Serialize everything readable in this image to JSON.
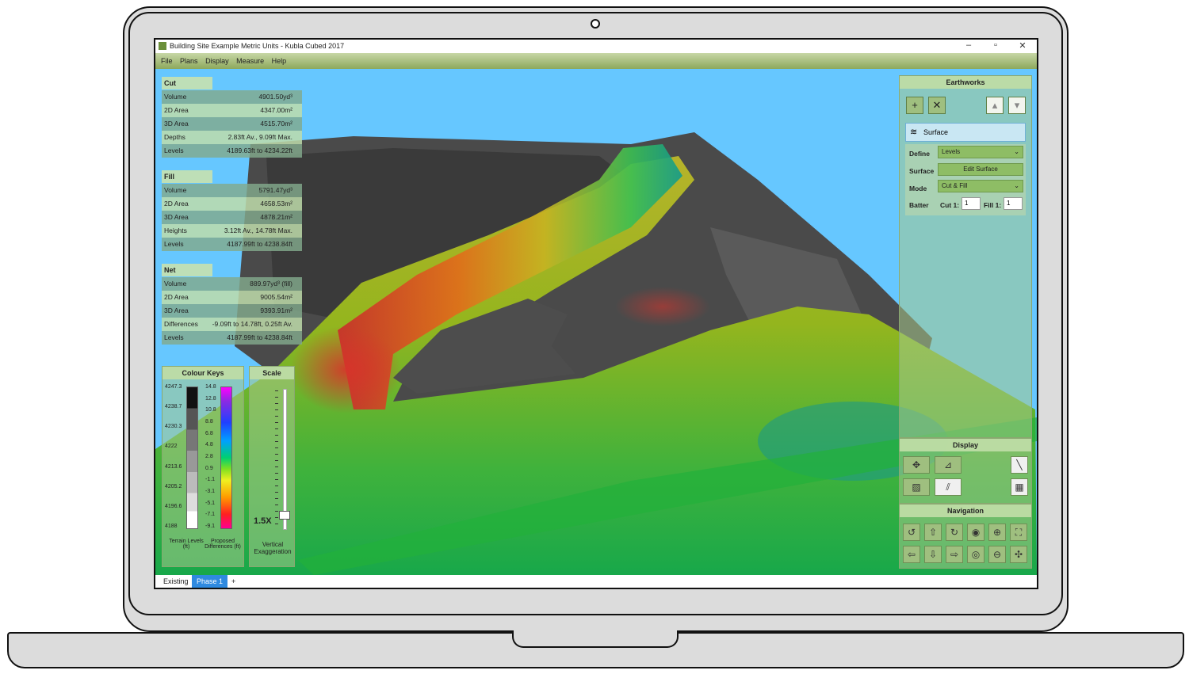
{
  "window": {
    "title": "Building Site Example Metric Units - Kubla Cubed 2017"
  },
  "menu": [
    "File",
    "Plans",
    "Display",
    "Measure",
    "Help"
  ],
  "cut": {
    "title": "Cut",
    "rows": [
      {
        "k": "Volume",
        "v": "4901.50yd³"
      },
      {
        "k": "2D Area",
        "v": "4347.00m²"
      },
      {
        "k": "3D Area",
        "v": "4515.70m²"
      },
      {
        "k": "Depths",
        "v": "2.83ft Av., 9.09ft Max."
      },
      {
        "k": "Levels",
        "v": "4189.63ft to 4234.22ft"
      }
    ]
  },
  "fill": {
    "title": "Fill",
    "rows": [
      {
        "k": "Volume",
        "v": "5791.47yd³"
      },
      {
        "k": "2D Area",
        "v": "4658.53m²"
      },
      {
        "k": "3D Area",
        "v": "4878.21m²"
      },
      {
        "k": "Heights",
        "v": "3.12ft Av., 14.78ft Max."
      },
      {
        "k": "Levels",
        "v": "4187.99ft to 4238.84ft"
      }
    ]
  },
  "net": {
    "title": "Net",
    "rows": [
      {
        "k": "Volume",
        "v": "889.97yd³ (fill)"
      },
      {
        "k": "2D Area",
        "v": "9005.54m²"
      },
      {
        "k": "3D Area",
        "v": "9393.91m²"
      },
      {
        "k": "Differences",
        "v": "-9.09ft to 14.78ft, 0.25ft Av."
      },
      {
        "k": "Levels",
        "v": "4187.99ft to 4238.84ft"
      }
    ]
  },
  "colour_keys": {
    "title": "Colour Keys",
    "terrain_ticks": [
      "4247.3",
      "4238.7",
      "4230.3",
      "4222",
      "4213.6",
      "4205.2",
      "4196.6",
      "4188"
    ],
    "diff_ticks": [
      "14.8",
      "12.8",
      "10.8",
      "8.8",
      "6.8",
      "4.8",
      "2.8",
      "0.9",
      "-1.1",
      "-3.1",
      "-5.1",
      "-7.1",
      "-9.1"
    ],
    "terrain_label": "Terrain Levels (ft)",
    "diff_label": "Proposed Differences (ft)"
  },
  "scale": {
    "title": "Scale",
    "value": "1.5X",
    "value_fraction": 0.1,
    "label": "Vertical Exaggeration"
  },
  "earthworks": {
    "title": "Earthworks",
    "surface_item": "Surface",
    "define_label": "Define",
    "define_value": "Levels",
    "surface_label": "Surface",
    "edit_surface_button": "Edit Surface",
    "mode_label": "Mode",
    "mode_value": "Cut & Fill",
    "batter_label": "Batter",
    "cut_label": "Cut 1:",
    "cut_value": "1",
    "fill_label": "Fill 1:",
    "fill_value": "1"
  },
  "display": {
    "title": "Display"
  },
  "navigation": {
    "title": "Navigation"
  },
  "tabs": [
    "Existing",
    "Phase 1",
    "+"
  ],
  "colors": {
    "sky": "#66c7ff",
    "active_tab": "#2f8ae0"
  }
}
